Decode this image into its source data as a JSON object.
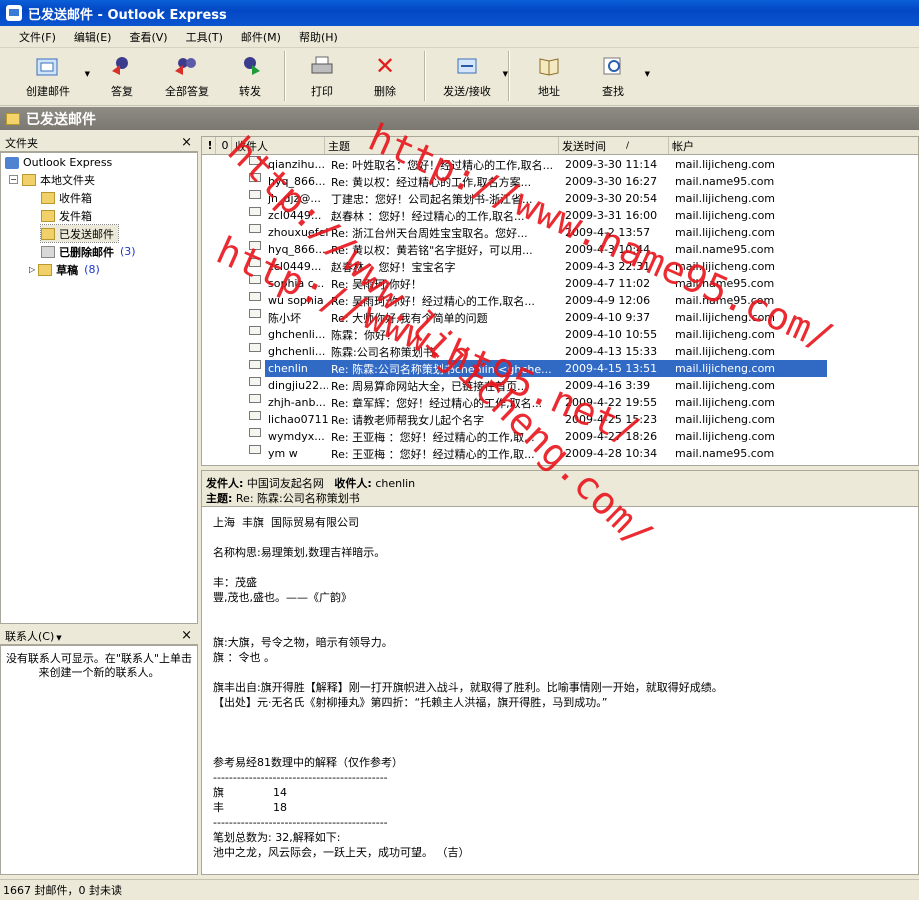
{
  "window": {
    "title": "已发送邮件 - Outlook Express"
  },
  "menu": [
    "文件(F)",
    "编辑(E)",
    "查看(V)",
    "工具(T)",
    "邮件(M)",
    "帮助(H)"
  ],
  "toolbar": {
    "new": "创建邮件",
    "reply": "答复",
    "reply_all": "全部答复",
    "forward": "转发",
    "print": "打印",
    "delete": "删除",
    "send_recv": "发送/接收",
    "addresses": "地址",
    "find": "查找"
  },
  "folder_header": "已发送邮件",
  "folders_pane": {
    "title": "文件夹",
    "close": "×",
    "items": [
      {
        "label": "Outlook Express"
      },
      {
        "label": "本地文件夹"
      },
      {
        "label": "收件箱"
      },
      {
        "label": "发件箱"
      },
      {
        "label": "已发送邮件"
      },
      {
        "label": "已删除邮件",
        "count": "(3)"
      },
      {
        "label": "草稿",
        "count": "(8)"
      }
    ]
  },
  "contacts_pane": {
    "title": "联系人(C)",
    "dropdown": "▼",
    "close": "×",
    "empty_text": "没有联系人可显示。在\"联系人\"上单击来创建一个新的联系人。"
  },
  "columns": {
    "flag": "!",
    "attach": "0",
    "to": "收件人",
    "subject": "主题",
    "sent": "发送时间",
    "sort": "/",
    "account": "帐户"
  },
  "messages": [
    {
      "to": "qianzihu...",
      "subject": "Re: 叶姓取名：您好！经过精心的工作,取名...",
      "date": "2009-3-30 11:14",
      "account": "mail.lijicheng.com"
    },
    {
      "to": "hyq_866...",
      "subject": "Re: 黄以权：经过精心的工作,取名方案...",
      "date": "2009-3-30 16:27",
      "account": "mail.name95.com"
    },
    {
      "to": "jh_djz@...",
      "subject": "丁建忠：您好！公司起名策划书-浙江省...",
      "date": "2009-3-30 20:54",
      "account": "mail.lijicheng.com"
    },
    {
      "to": "zcl0449...",
      "subject": "赵春林 ：您好！经过精心的工作,取名...",
      "date": "2009-3-31 16:00",
      "account": "mail.lijicheng.com"
    },
    {
      "to": "zhouxuefei",
      "subject": "Re: 浙江台州天台周姓宝宝取名。您好...",
      "date": "2009-4-2 13:57",
      "account": "mail.lijicheng.com"
    },
    {
      "to": "hyq_866...",
      "subject": "Re: 黄以权：黄若铭\"名字挺好，可以用...",
      "date": "2009-4-3 10:44",
      "account": "mail.name95.com"
    },
    {
      "to": "zcl0449...",
      "subject": "赵春林 ：您好！宝宝名字",
      "date": "2009-4-3 22:31",
      "account": "mail.lijicheng.com"
    },
    {
      "to": "sophia c...",
      "subject": "Re: 吴雨珂:你好！",
      "date": "2009-4-7 11:02",
      "account": "mail.name95.com"
    },
    {
      "to": "wu sophia",
      "subject": "Re: 吴雨珂:你好！经过精心的工作,取名...",
      "date": "2009-4-9 12:06",
      "account": "mail.name95.com"
    },
    {
      "to": "陈小坏",
      "subject": "Re: 大师你好,我有个简单的问题",
      "date": "2009-4-10 9:37",
      "account": "mail.lijicheng.com"
    },
    {
      "to": "ghchenli...",
      "subject": "陈霖：你好！",
      "date": "2009-4-10 10:55",
      "account": "mail.lijicheng.com"
    },
    {
      "to": "ghchenli...",
      "subject": "陈霖:公司名称策划书",
      "date": "2009-4-13 15:33",
      "account": "mail.lijicheng.com"
    },
    {
      "to": "chenlin",
      "subject": "Re: 陈霖:公司名称策划书chenlin <ghche...",
      "date": "2009-4-15 13:51",
      "account": "mail.lijicheng.com",
      "selected": true
    },
    {
      "to": "dingjiu22...",
      "subject": "Re: 周易算命网站大全，已链接在首页...",
      "date": "2009-4-16 3:39",
      "account": "mail.lijicheng.com"
    },
    {
      "to": "zhjh-anb...",
      "subject": "Re: 章军辉：您好！经过精心的工作,取名...",
      "date": "2009-4-22 19:55",
      "account": "mail.lijicheng.com"
    },
    {
      "to": "lichao0711",
      "subject": "Re: 请教老师帮我女儿起个名字",
      "date": "2009-4-25 15:23",
      "account": "mail.lijicheng.com"
    },
    {
      "to": "wymdyx...",
      "subject": "Re: 王亚梅 ：您好！经过精心的工作,取...",
      "date": "2009-4-27 18:26",
      "account": "mail.lijicheng.com"
    },
    {
      "to": "ym w",
      "subject": "Re: 王亚梅 ：您好！经过精心的工作,取...",
      "date": "2009-4-28 10:34",
      "account": "mail.name95.com"
    }
  ],
  "preview": {
    "from_label": "发件人:",
    "from": "中国词友起名网",
    "to_label": "收件人:",
    "to": "chenlin",
    "subject_label": "主题:",
    "subject": "Re: 陈霖:公司名称策划书",
    "body": "上海  丰旗  国际贸易有限公司\n\n名称构思:易理策划,数理吉祥暗示。\n\n丰：茂盛\n豐,茂也,盛也。——《广韵》\n\n\n旗:大旗，号令之物，暗示有领导力。\n旗 ：令也 。\n\n旗丰出自:旗开得胜【解释】刚一打开旗帜进入战斗，就取得了胜利。比喻事情刚一开始，就取得好成绩。\n【出处】元·无名氏《射柳捶丸》第四折：“托赖主人洪福，旗开得胜，马到成功。”\n\n\n\n参考易经81数理中的解释（仅作参考）\n--------------------------------------------\n旗              14\n丰              18\n--------------------------------------------\n笔划总数为: 32,解释如下:\n池中之龙，风云际会，一跃上天，成功可望。 （吉）"
  },
  "status": "1667 封邮件，0 封未读",
  "watermarks": [
    "http://www.lijicheng.com/",
    "http://www.name95.com/",
    "http://www.ht95.net/"
  ]
}
